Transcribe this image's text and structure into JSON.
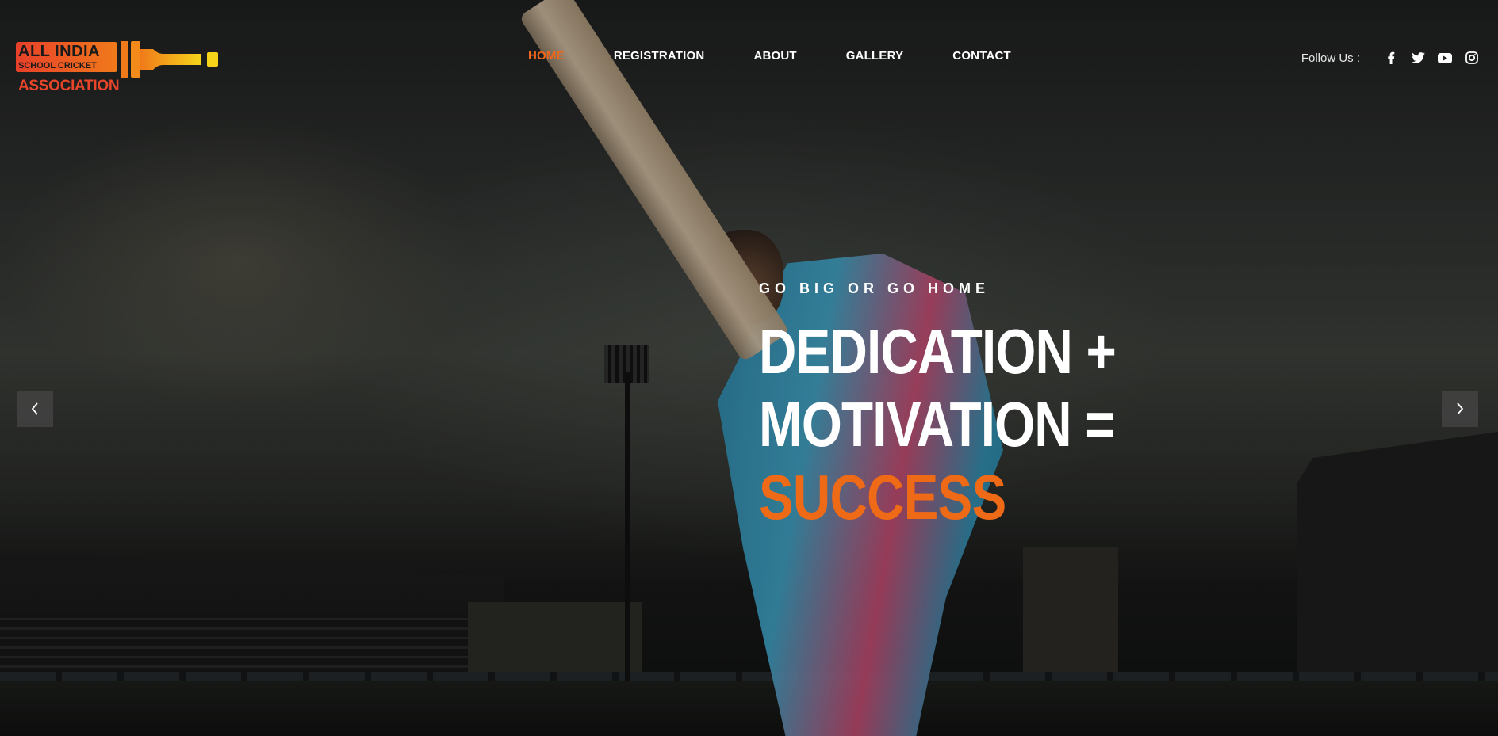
{
  "brand": {
    "logo_line1": "ALL INDIA",
    "logo_line2": "SCHOOL CRICKET",
    "logo_line3": "ASSOCIATION",
    "colors": {
      "primary": "#ef6a16",
      "logo_red": "#e8402a",
      "logo_yellow": "#f5c518"
    }
  },
  "nav": {
    "items": [
      {
        "label": "HOME",
        "active": true
      },
      {
        "label": "REGISTRATION",
        "active": false
      },
      {
        "label": "ABOUT",
        "active": false
      },
      {
        "label": "GALLERY",
        "active": false
      },
      {
        "label": "CONTACT",
        "active": false
      }
    ]
  },
  "social": {
    "label": "Follow Us :",
    "icons": [
      "facebook-icon",
      "twitter-icon",
      "youtube-icon",
      "instagram-icon"
    ]
  },
  "hero": {
    "tagline": "GO BIG OR GO HOME",
    "line1": "DEDICATION +",
    "line2": "MOTIVATION =",
    "line3": "SUCCESS"
  },
  "slider": {
    "prev_icon": "chevron-left-icon",
    "next_icon": "chevron-right-icon"
  }
}
